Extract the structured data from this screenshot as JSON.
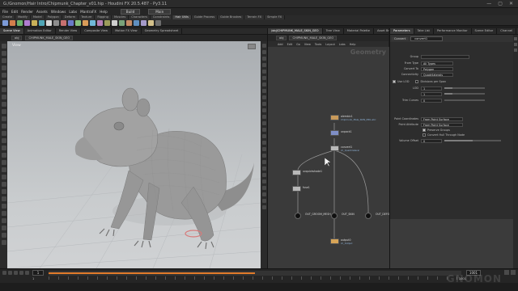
{
  "window": {
    "title": "G:/Gnomon/Hair Intro/Chipmunk_Chapter_v01.hip - Houdini FX 20.5.487 - Py3.11",
    "controls": [
      "—",
      "▢",
      "✕"
    ]
  },
  "menu": {
    "items": [
      "File",
      "Edit",
      "Render",
      "Assets",
      "Windows",
      "Labs",
      "MantraFX",
      "Help"
    ],
    "build_label": "Build",
    "desktop_label": "Main"
  },
  "shelf": {
    "tabs": [
      "Create",
      "Modify",
      "Model",
      "Polygon",
      "Deform",
      "Texture",
      "Rigging",
      "Muscles",
      "Characters",
      "Constraints",
      "Hair Utils",
      "Guide Process",
      "Guide Brushes",
      "Terrain FX",
      "Simple FX"
    ],
    "active_tab": 10,
    "icon_colors": [
      "#7c9bd8",
      "#d37f4c",
      "#6bb36b",
      "#b07cd0",
      "#c9b158",
      "#4fa6b6",
      "#d6d6d6",
      "#8d8d8d",
      "#c77070",
      "#6a7bc9",
      "#88c27c",
      "#d99c58",
      "#6fb8d8",
      "#b77fb7",
      "#9c9c5b",
      "#cfcfcf",
      "#7aa37a",
      "#c48a64",
      "#5f8fbf",
      "#a59ac9",
      "#d3c08a",
      "#6d6d6d"
    ]
  },
  "viewport": {
    "tabs": [
      "Scene View",
      "Animation Editor",
      "Render View",
      "Composite View",
      "Motion FX View",
      "Geometry Spreadsheet"
    ],
    "active_tab": 0,
    "path": [
      "obj",
      "CHIPMUNK_MALE_SKIN_GEO"
    ],
    "view_label": "View"
  },
  "network": {
    "tabs": [
      "/obj/CHIPMUNK_MALE_SKIN_GEO",
      "Tree View",
      "Material Palette",
      "Asset Browser"
    ],
    "active_tab": 0,
    "path": [
      "obj",
      "CHIPMUNK_MALE_SKIN_GEO"
    ],
    "menu": [
      "Add",
      "Edit",
      "Go",
      "View",
      "Tools",
      "Layout",
      "Labs",
      "Help"
    ],
    "context_label": "Geometry",
    "nodes": [
      {
        "name": "alembic1",
        "sub": "Chipmunk_Male_SKIN_MDL.abc"
      },
      {
        "name": "unpack1",
        "sub": ""
      },
      {
        "name": "convert1",
        "sub": "ch_Quadrilateral"
      },
      {
        "name": "uvquickshade1",
        "sub": ""
      },
      {
        "name": "fuse1",
        "sub": ""
      },
      {
        "name": "OUT_GROOM_MESH_",
        "sub": ""
      },
      {
        "name": "OUT_SKIN",
        "sub": ""
      },
      {
        "name": "OUT_DEFORMER",
        "sub": ""
      },
      {
        "name": "output0",
        "sub": "ch_Output"
      }
    ]
  },
  "params": {
    "tabs": [
      "Parameters",
      "Take List",
      "Performance Monitor",
      "Scene Editor",
      "Channel"
    ],
    "active_tab": 0,
    "node_type": "Convert",
    "node_name": "convert1",
    "rows": [
      {
        "label": "Group",
        "value": ""
      },
      {
        "label": "From Type",
        "value": "All Types"
      },
      {
        "label": "Convert To",
        "value": "Polygon"
      },
      {
        "label": "Connectivity",
        "value": "Quadrilaterals"
      }
    ],
    "lod_checkbox": "Use LOD",
    "lod_label": "LOD",
    "divisions_checkbox": "Divisions per Span",
    "u_value": "1",
    "v_value": "1",
    "trim_label": "Trim Curves",
    "trim_value": "0",
    "coord_rows": [
      {
        "label": "Point Coordinates",
        "value": "From Point Surface"
      },
      {
        "label": "Point Attribute",
        "value": "From Point Surface"
      }
    ],
    "check_rows": [
      {
        "label": "Preserve Groups",
        "checked": true
      },
      {
        "label": "Convert Hull Through Node",
        "checked": false
      }
    ],
    "offset_label": "Volume Offset",
    "offset_value": "0"
  },
  "timeline": {
    "frame": "1",
    "start": "1",
    "end": "1001",
    "range_start": "1",
    "range_end": "1001",
    "progress": 0.5
  },
  "watermark": "GNOMON",
  "colors": {
    "accent": "#e07a2a",
    "node_default": "#8a8a8a",
    "node_selected": "#e8c16a"
  }
}
